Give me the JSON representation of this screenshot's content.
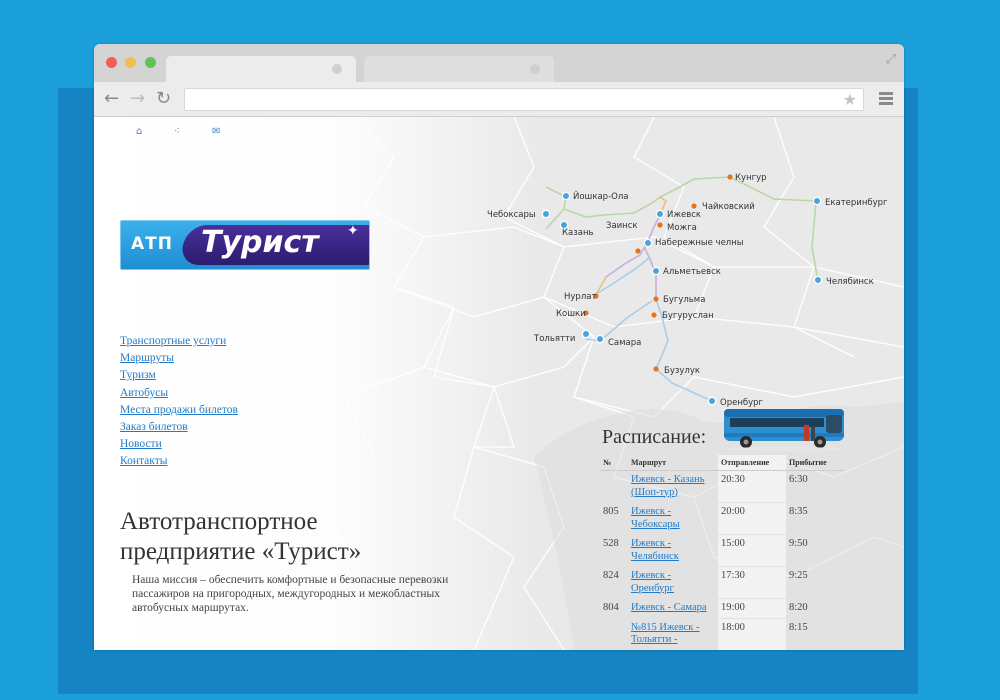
{
  "colors": {
    "background": "#1a9fdb",
    "link": "#1f7bc9",
    "route_orange": "#e8731e",
    "route_blue": "#4aa3dc"
  },
  "browser": {
    "back_icon": "back-arrow-icon",
    "forward_icon": "forward-arrow-icon",
    "reload_icon": "reload-icon",
    "star_icon": "star-icon",
    "menu_icon": "hamburger-menu-icon",
    "expand_icon": "expand-icon"
  },
  "top_icons": [
    "home-icon",
    "sitemap-icon",
    "mail-icon"
  ],
  "logo": {
    "abbr": "АТП",
    "name": "Турист"
  },
  "nav": [
    "Транспортные услуги",
    "Маршруты",
    "Туризм",
    "Автобусы",
    "Места продажи билетов",
    "Заказ билетов",
    "Новости",
    "Контакты"
  ],
  "headline": {
    "line1": "Автотранспортное",
    "line2": "предприятие «Турист»"
  },
  "mission": "Наша миссия – обеспечить комфортные и безопасные перевозки пассажиров на пригородных, междугородных и межобластных автобусных маршрутах.",
  "map_cities": [
    "Кунгур",
    "Чайковский",
    "Екатеринбург",
    "Ижевск",
    "Можга",
    "Йошкар-Ола",
    "Чебоксары",
    "Казань",
    "Заинск",
    "Набережные челны",
    "Альметьевск",
    "Нурлат",
    "Кошки",
    "Бугульма",
    "Бугуруслан",
    "Тольятти",
    "Самара",
    "Челябинск",
    "Бузулук",
    "Оренбург"
  ],
  "schedule": {
    "title": "Расписание:",
    "columns": [
      "№",
      "Маршрут",
      "Отправление",
      "Прибытие"
    ],
    "rows": [
      {
        "num": "",
        "route": "Ижевск - Казань (Шоп-тур)",
        "depart": "20:30",
        "arrive": "6:30"
      },
      {
        "num": "805",
        "route": "Ижевск - Чебоксары",
        "depart": "20:00",
        "arrive": "8:35"
      },
      {
        "num": "528",
        "route": "Ижевск - Челябинск",
        "depart": "15:00",
        "arrive": "9:50"
      },
      {
        "num": "824",
        "route": "Ижевск - Оренбург",
        "depart": "17:30",
        "arrive": "9:25"
      },
      {
        "num": "804",
        "route": "Ижевск - Самара",
        "depart": "19:00",
        "arrive": "8:20"
      },
      {
        "num": "",
        "route": "№815 Ижевск - Тольятти -",
        "depart": "18:00",
        "arrive": "8:15"
      }
    ]
  }
}
